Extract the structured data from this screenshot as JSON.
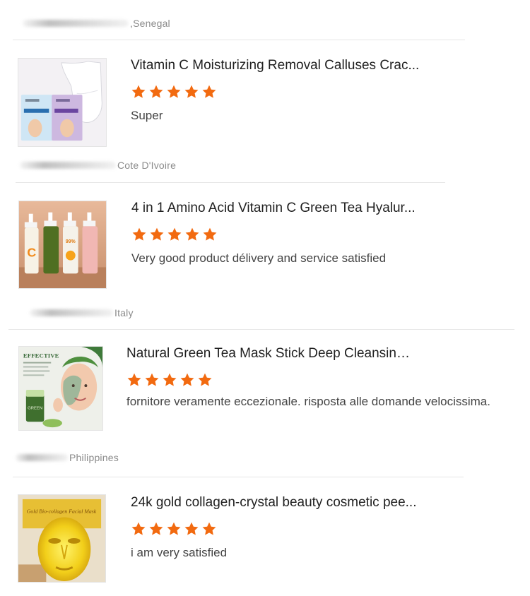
{
  "reviews": [
    {
      "country": "Senegal",
      "product_title": "Vitamin C Moisturizing Removal Calluses Crac...",
      "rating": 5,
      "comment": "Super",
      "thumb_icon": "foot-mask-product-image"
    },
    {
      "country": "Cote D'Ivoire",
      "product_title": "4 in 1 Amino Acid Vitamin C Green Tea Hyalur...",
      "rating": 5,
      "comment": "Very good product délivery and service satisfied",
      "thumb_icon": "cleanser-bottles-product-image"
    },
    {
      "country": "Italy",
      "product_title": "Natural Green Tea Mask Stick Deep Cleansing ...",
      "rating": 5,
      "comment": "fornitore veramente eccezionale. risposta alle domande velocissima.",
      "thumb_icon": "green-tea-mask-stick-product-image",
      "thumb_text": "EFFECTIVE",
      "thumb_stick_label": "GREEN"
    },
    {
      "country": "Philippines",
      "product_title": "24k gold collagen-crystal beauty cosmetic pee...",
      "rating": 5,
      "comment": "i am very satisfied",
      "thumb_icon": "gold-collagen-mask-product-image",
      "thumb_text": "Gold Bio-collagen Facial Mask"
    }
  ],
  "colors": {
    "star": "#f26a10",
    "divider": "#e6e6e6",
    "meta_text": "#8a8a8a"
  }
}
